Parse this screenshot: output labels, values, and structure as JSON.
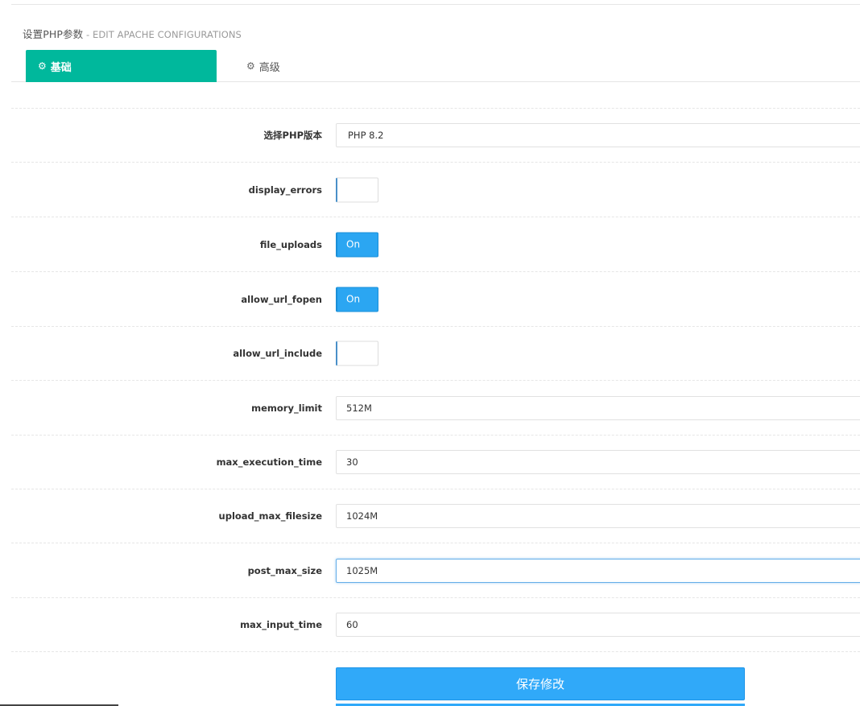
{
  "header": {
    "title": "设置PHP参数",
    "subtitle": " - EDIT APACHE CONFIGURATIONS"
  },
  "tabs": [
    {
      "label": "基础",
      "icon": "gear-icon",
      "active": true
    },
    {
      "label": "高级",
      "icon": "gears-icon",
      "active": false
    }
  ],
  "form": {
    "php_version": {
      "label": "选择PHP版本",
      "value": "PHP 8.2"
    },
    "display_errors": {
      "label": "display_errors",
      "value": ""
    },
    "file_uploads": {
      "label": "file_uploads",
      "value": "On"
    },
    "allow_url_fopen": {
      "label": "allow_url_fopen",
      "value": "On"
    },
    "allow_url_include": {
      "label": "allow_url_include",
      "value": ""
    },
    "memory_limit": {
      "label": "memory_limit",
      "value": "512M"
    },
    "max_execution_time": {
      "label": "max_execution_time",
      "value": "30"
    },
    "upload_max_filesize": {
      "label": "upload_max_filesize",
      "value": "1024M"
    },
    "post_max_size": {
      "label": "post_max_size",
      "value": "1025M"
    },
    "max_input_time": {
      "label": "max_input_time",
      "value": "60"
    }
  },
  "actions": {
    "save_label": "保存修改"
  },
  "colors": {
    "tab_active": "#00b89c",
    "toggle_on": "#2ba6f2",
    "save_button": "#30a9f9"
  }
}
